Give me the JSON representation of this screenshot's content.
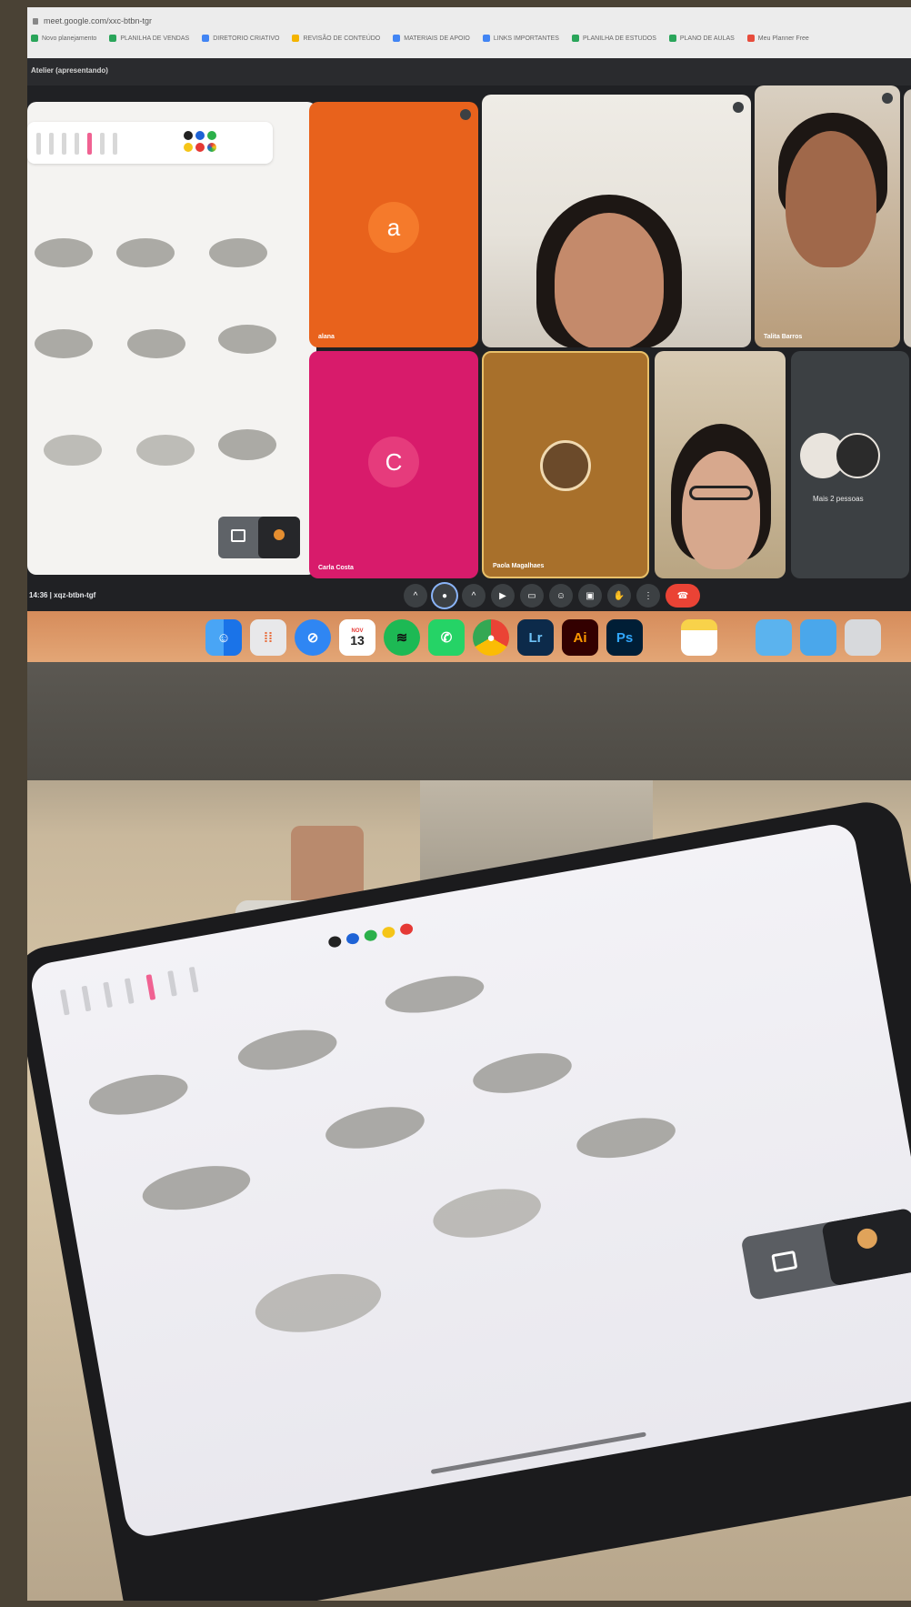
{
  "browser": {
    "url": "meet.google.com/xxc-btbn-tgr",
    "bookmarks": [
      "Novo planejamento",
      "PLANILHA DE VENDAS",
      "DIRETORIO CRIATIVO",
      "REVISÃO DE CONTEÚDO",
      "MATERIAIS DE APOIO",
      "LINKS IMPORTANTES",
      "PLANILHA DE ESTUDOS",
      "PLANO DE AULAS",
      "Meu Planner Free"
    ]
  },
  "meet": {
    "title": "Atelier (apresentando)",
    "participants": [
      {
        "name": "alana",
        "initial": "a",
        "color": "#e8621c"
      },
      {
        "name": "Carla Costa",
        "initial": "C",
        "color": "#d81b6b"
      },
      {
        "name": "Paola Magalhaes",
        "color": "#c98a3a"
      },
      {
        "name": "Talita Barros"
      }
    ],
    "more_label": "Mais 2 pessoas",
    "meeting_code": "14:36 | xqz-btbn-tgf",
    "controls": [
      "mic-icon",
      "camera-icon",
      "captions-icon",
      "present-icon",
      "emoji-icon",
      "hand-icon",
      "more-icon",
      "end-call-icon"
    ]
  },
  "dock": {
    "apps": [
      "Finder",
      "Launchpad",
      "Safari",
      "Calendar",
      "Spotify",
      "WhatsApp",
      "Chrome",
      "Lr",
      "Ai",
      "Ps",
      "Notes",
      "Folder",
      "Downloads",
      "Trash"
    ],
    "calendar_day": "13",
    "calendar_month": "NOV"
  },
  "colors": {
    "orange_tile": "#e8621c",
    "pink_tile": "#d81b6b",
    "gold_tile": "#c98a3a",
    "end_call": "#ea4335"
  }
}
